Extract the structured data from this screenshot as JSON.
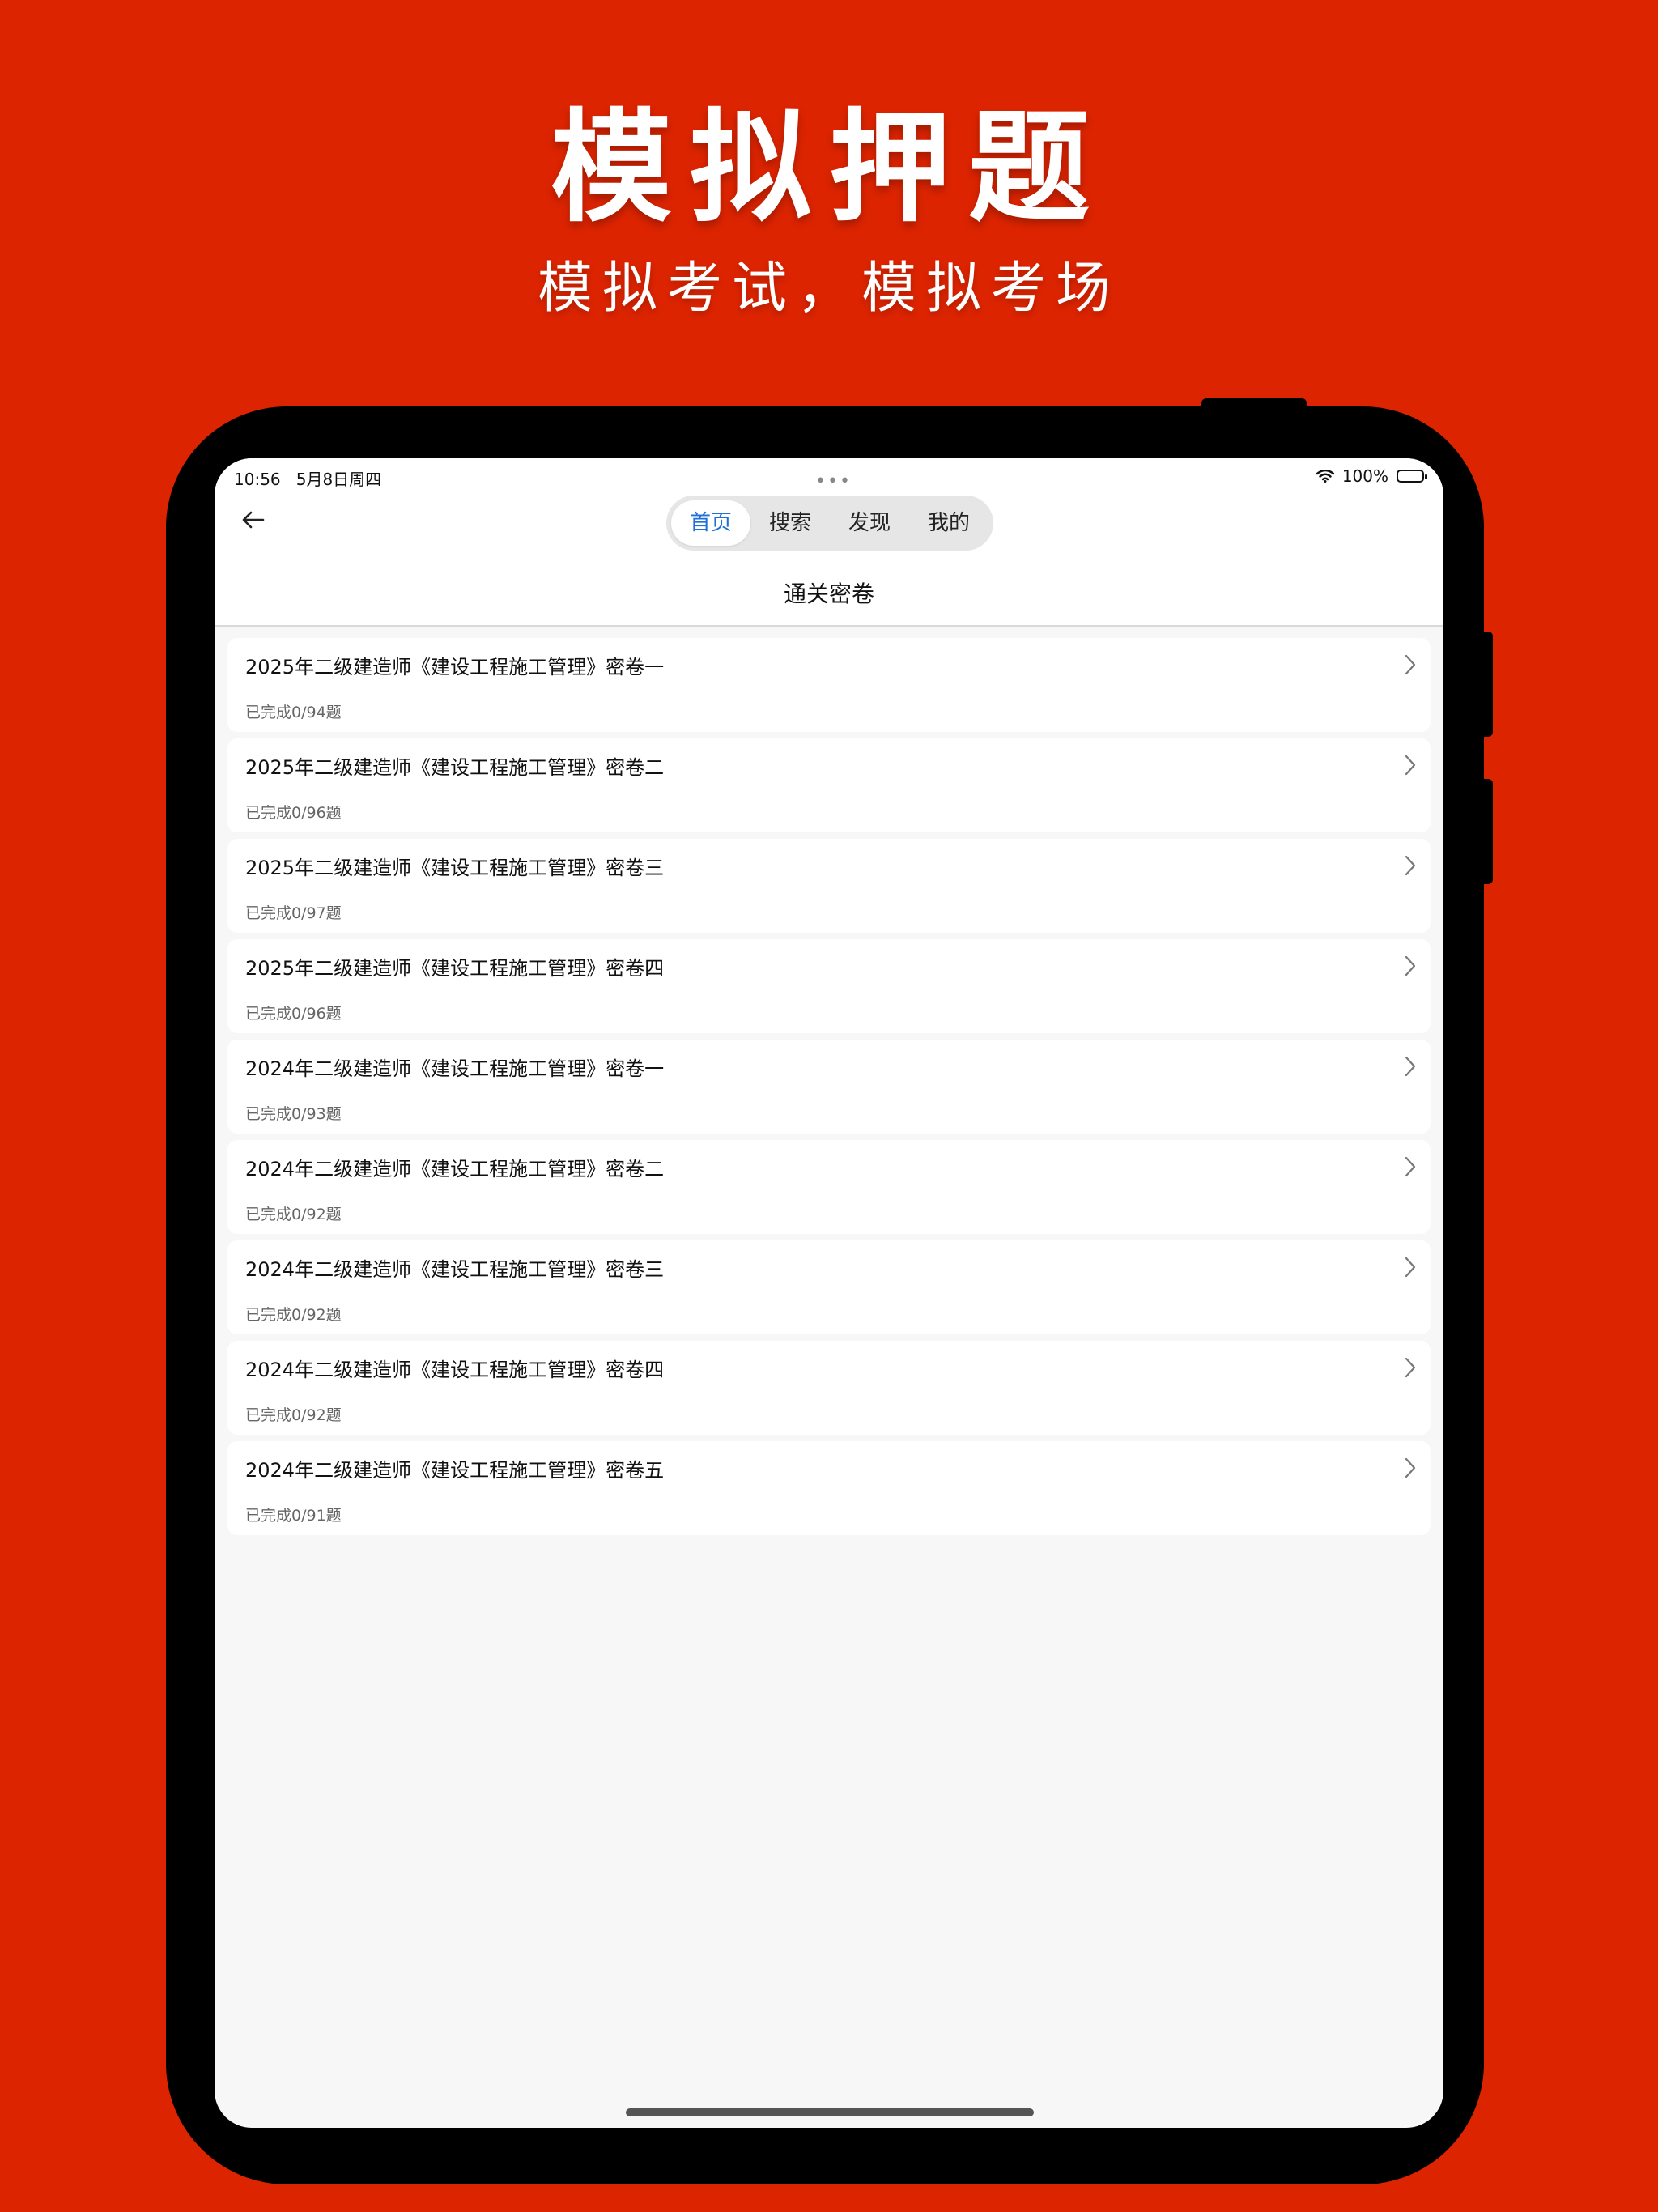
{
  "promo": {
    "title": "模拟押题",
    "subtitle": "模拟考试，模拟考场"
  },
  "status_bar": {
    "time": "10:56",
    "date": "5月8日周四",
    "battery": "100%",
    "dots": "•••"
  },
  "nav": {
    "tabs": [
      {
        "label": "首页",
        "active": true
      },
      {
        "label": "搜索",
        "active": false
      },
      {
        "label": "发现",
        "active": false
      },
      {
        "label": "我的",
        "active": false
      }
    ],
    "page_title": "通关密卷"
  },
  "papers": [
    {
      "title": "2025年二级建造师《建设工程施工管理》密卷一",
      "progress": "已完成0/94题"
    },
    {
      "title": "2025年二级建造师《建设工程施工管理》密卷二",
      "progress": "已完成0/96题"
    },
    {
      "title": "2025年二级建造师《建设工程施工管理》密卷三",
      "progress": "已完成0/97题"
    },
    {
      "title": "2025年二级建造师《建设工程施工管理》密卷四",
      "progress": "已完成0/96题"
    },
    {
      "title": "2024年二级建造师《建设工程施工管理》密卷一",
      "progress": "已完成0/93题"
    },
    {
      "title": "2024年二级建造师《建设工程施工管理》密卷二",
      "progress": "已完成0/92题"
    },
    {
      "title": "2024年二级建造师《建设工程施工管理》密卷三",
      "progress": "已完成0/92题"
    },
    {
      "title": "2024年二级建造师《建设工程施工管理》密卷四",
      "progress": "已完成0/92题"
    },
    {
      "title": "2024年二级建造师《建设工程施工管理》密卷五",
      "progress": "已完成0/91题"
    }
  ],
  "colors": {
    "background": "#dd2400",
    "active_tab": "#1f6fd6"
  }
}
